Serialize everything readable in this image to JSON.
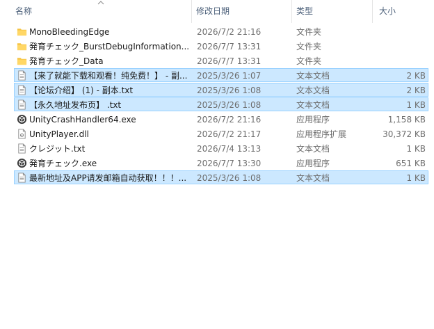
{
  "columns": {
    "name": "名称",
    "date": "修改日期",
    "type": "类型",
    "size": "大小"
  },
  "sort_column": "name",
  "files": [
    {
      "name": "MonoBleedingEdge",
      "date": "2026/7/2 21:16",
      "type": "文件夹",
      "size": "",
      "icon": "folder-icon",
      "selected": false
    },
    {
      "name": "発育チェック_BurstDebugInformation...",
      "date": "2026/7/7 13:31",
      "type": "文件夹",
      "size": "",
      "icon": "folder-icon",
      "selected": false
    },
    {
      "name": "発育チェック_Data",
      "date": "2026/7/7 13:31",
      "type": "文件夹",
      "size": "",
      "icon": "folder-icon",
      "selected": false
    },
    {
      "name": "【来了就能下载和观看！纯免费！】 - 副...",
      "date": "2025/3/26 1:07",
      "type": "文本文档",
      "size": "2 KB",
      "icon": "text-file-icon",
      "selected": true
    },
    {
      "name": "【论坛介绍】 (1) - 副本.txt",
      "date": "2025/3/26 1:08",
      "type": "文本文档",
      "size": "2 KB",
      "icon": "text-file-icon",
      "selected": true
    },
    {
      "name": "【永久地址发布页】 .txt",
      "date": "2025/3/26 1:08",
      "type": "文本文档",
      "size": "1 KB",
      "icon": "text-file-icon",
      "selected": true
    },
    {
      "name": "UnityCrashHandler64.exe",
      "date": "2026/7/2 21:16",
      "type": "应用程序",
      "size": "1,158 KB",
      "icon": "unity-app-icon",
      "selected": false
    },
    {
      "name": "UnityPlayer.dll",
      "date": "2026/7/2 21:17",
      "type": "应用程序扩展",
      "size": "30,372 KB",
      "icon": "dll-file-icon",
      "selected": false
    },
    {
      "name": "クレジット.txt",
      "date": "2026/7/4 13:13",
      "type": "文本文档",
      "size": "1 KB",
      "icon": "text-file-icon",
      "selected": false
    },
    {
      "name": "発育チェック.exe",
      "date": "2026/7/7 13:30",
      "type": "应用程序",
      "size": "651 KB",
      "icon": "unity-app-icon",
      "selected": false
    },
    {
      "name": "最新地址及APP请发邮箱自动获取！！！...",
      "date": "2025/3/26 1:08",
      "type": "文本文档",
      "size": "1 KB",
      "icon": "text-file-icon",
      "selected": true
    }
  ],
  "colors": {
    "selected_bg": "#cce8ff",
    "selected_border": "#99d1ff",
    "folder": "#f5c342",
    "header_text": "#4c607a"
  }
}
